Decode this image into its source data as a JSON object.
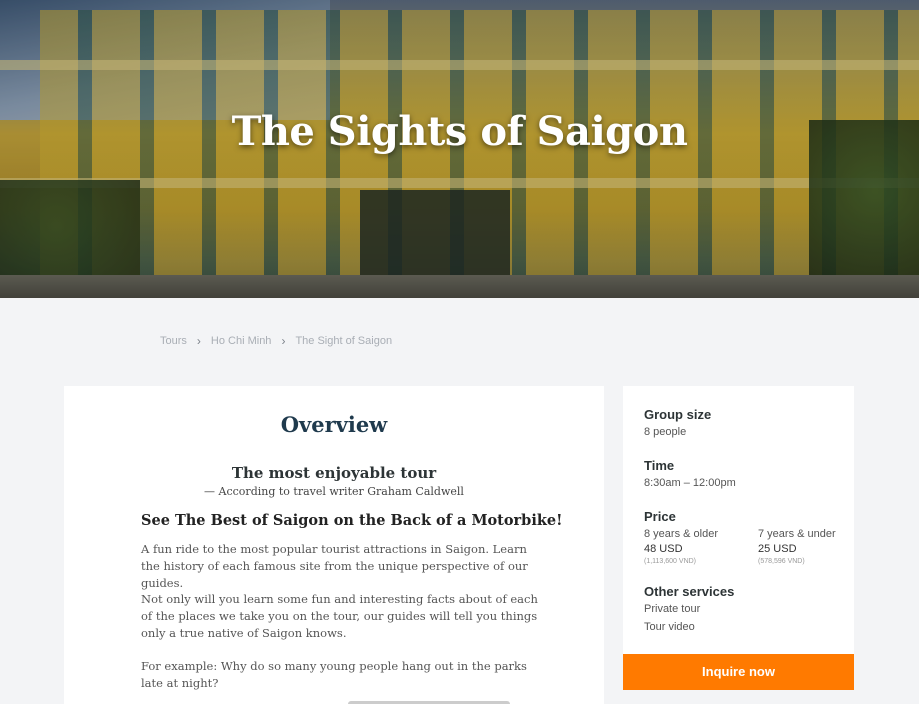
{
  "hero": {
    "title": "The Sights of Saigon"
  },
  "breadcrumb": {
    "items": [
      "Tours",
      "Ho Chi Minh",
      "The Sight of Saigon"
    ]
  },
  "overview": {
    "heading": "Overview",
    "subtitle": "The most enjoyable tour",
    "attribution": "— According to travel writer Graham Caldwell",
    "section_title": "See The Best of Saigon on the Back of a Motorbike!",
    "paragraphs": [
      "A fun ride to the most popular tourist attractions in Saigon. Learn the history of each famous site from the unique perspective of our guides.",
      "Not only will you learn some fun and interesting facts about of each of the places we take you on the tour, our guides will tell you things only a true native of Saigon knows.",
      "For example: Why do so many young people hang out in the parks late at night?"
    ]
  },
  "sidebar": {
    "group_size": {
      "label": "Group size",
      "value": "8 people"
    },
    "time": {
      "label": "Time",
      "value": "8:30am – 12:00pm"
    },
    "price": {
      "label": "Price",
      "adult": {
        "label": "8 years & older",
        "usd": "48 USD",
        "vnd": "(1,113,600 VND)"
      },
      "child": {
        "label": "7 years & under",
        "usd": "25 USD",
        "vnd": "(578,596 VND)"
      }
    },
    "other_services": {
      "label": "Other services",
      "items": [
        "Private tour",
        "Tour video"
      ]
    },
    "cta": "Inquire now"
  },
  "colors": {
    "accent": "#ff7a00",
    "heading": "#1f3a4d",
    "background": "#f3f4f6"
  }
}
